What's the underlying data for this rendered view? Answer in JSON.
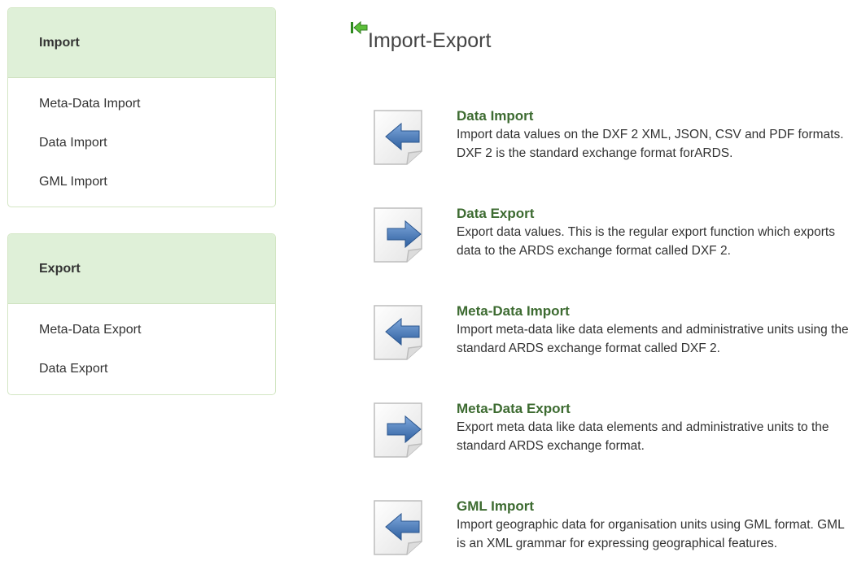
{
  "sidebar": {
    "import": {
      "heading": "Import",
      "items": [
        "Meta-Data Import",
        "Data Import",
        "GML Import"
      ]
    },
    "export": {
      "heading": "Export",
      "items": [
        "Meta-Data Export",
        "Data Export"
      ]
    }
  },
  "main": {
    "title": "Import-Export",
    "title_icon": "back-arrow-icon",
    "entries": [
      {
        "title": "Data Import",
        "description": "Import data values on the DXF 2 XML, JSON, CSV and PDF formats. DXF 2 is the standard exchange format forARDS.",
        "icon": "import-document-icon"
      },
      {
        "title": "Data Export",
        "description": "Export data values. This is the regular export function which exports data to the ARDS exchange format called DXF 2.",
        "icon": "export-document-icon"
      },
      {
        "title": "Meta-Data Import",
        "description": "Import meta-data like data elements and administrative units using the standard ARDS exchange format called DXF 2.",
        "icon": "import-document-icon"
      },
      {
        "title": "Meta-Data Export",
        "description": "Export meta data like data elements and administrative units to the standard ARDS exchange format.",
        "icon": "export-document-icon"
      },
      {
        "title": "GML Import",
        "description": "Import geographic data for organisation units using GML format. GML is an XML grammar for expressing geographical features.",
        "icon": "import-document-icon"
      }
    ]
  },
  "colors": {
    "panel_header_bg": "#dff0d8",
    "link_green": "#3d6b31",
    "arrow_blue": "#3f74b8"
  }
}
